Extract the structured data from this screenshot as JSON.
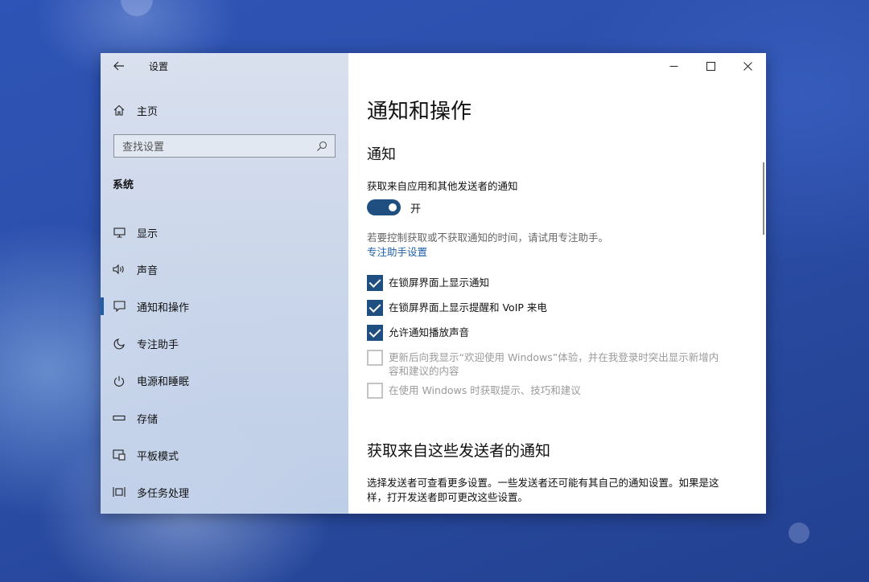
{
  "colors": {
    "accent": "#1e4f80",
    "link": "#1e5fa8",
    "desktop": "#2c4ea8"
  },
  "sidebar": {
    "back_icon": "back-arrow-icon",
    "app_title": "设置",
    "home": {
      "label": "主页",
      "icon": "home-icon"
    },
    "search": {
      "placeholder": "查找设置",
      "icon": "search-icon"
    },
    "section_heading": "系统",
    "items": [
      {
        "label": "显示",
        "icon": "monitor-icon",
        "selected": false
      },
      {
        "label": "声音",
        "icon": "speaker-icon",
        "selected": false
      },
      {
        "label": "通知和操作",
        "icon": "message-icon",
        "selected": true
      },
      {
        "label": "专注助手",
        "icon": "moon-icon",
        "selected": false
      },
      {
        "label": "电源和睡眠",
        "icon": "power-icon",
        "selected": false
      },
      {
        "label": "存储",
        "icon": "storage-icon",
        "selected": false
      },
      {
        "label": "平板模式",
        "icon": "tablet-icon",
        "selected": false
      },
      {
        "label": "多任务处理",
        "icon": "multitask-icon",
        "selected": false
      }
    ]
  },
  "window_controls": {
    "minimize": "minimize-icon",
    "maximize": "maximize-icon",
    "close": "close-icon"
  },
  "main": {
    "title": "通知和操作",
    "notifications_heading": "通知",
    "get_notifications_label": "获取来自应用和其他发送者的通知",
    "toggle": {
      "state_label": "开",
      "on": true
    },
    "hint_text": "若要控制获取或不获取通知的时间，请试用专注助手。",
    "focus_link": "专注助手设置",
    "checkboxes": [
      {
        "label": "在锁屏界面上显示通知",
        "checked": true,
        "enabled": true
      },
      {
        "label": "在锁屏界面上显示提醒和 VoIP 来电",
        "checked": true,
        "enabled": true
      },
      {
        "label": "允许通知播放声音",
        "checked": true,
        "enabled": true
      },
      {
        "label": "更新后向我显示“欢迎使用 Windows”体验，并在我登录时突出显示新增内容和建议的内容",
        "checked": false,
        "enabled": false
      },
      {
        "label": "在使用 Windows 时获取提示、技巧和建议",
        "checked": false,
        "enabled": false
      }
    ],
    "senders_heading": "获取来自这些发送者的通知",
    "senders_paragraph": "选择发送者可查看更多设置。一些发送者还可能有其自己的通知设置。如果是这样，打开发送者即可更改这些设置。"
  }
}
